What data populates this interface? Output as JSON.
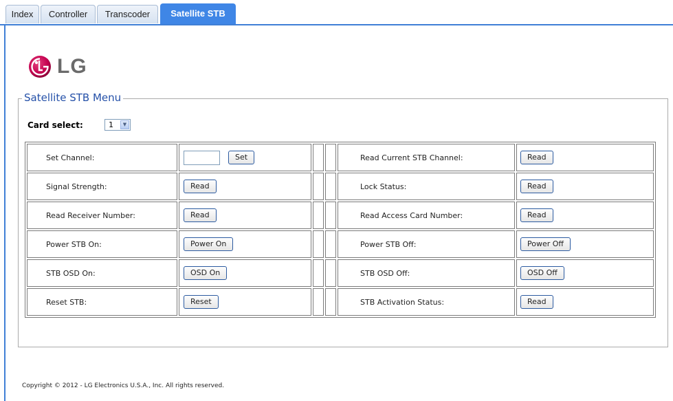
{
  "tabs": [
    {
      "label": "Index"
    },
    {
      "label": "Controller"
    },
    {
      "label": "Transcoder"
    },
    {
      "label": "Satellite STB",
      "active": true
    }
  ],
  "logo": {
    "text": "LG"
  },
  "menu": {
    "legend": "Satellite STB Menu",
    "card_select_label": "Card select:",
    "card_select_value": "1"
  },
  "rows": [
    {
      "left_label": "Set Channel:",
      "left_button": "Set",
      "right_label": "Read Current STB Channel:",
      "right_button": "Read"
    },
    {
      "left_label": "Signal Strength:",
      "left_button": "Read",
      "right_label": "Lock Status:",
      "right_button": "Read"
    },
    {
      "left_label": "Read Receiver Number:",
      "left_button": "Read",
      "right_label": "Read Access Card Number:",
      "right_button": "Read"
    },
    {
      "left_label": "Power STB On:",
      "left_button": "Power On",
      "right_label": "Power STB Off:",
      "right_button": "Power Off"
    },
    {
      "left_label": "STB OSD On:",
      "left_button": "OSD On",
      "right_label": "STB OSD Off:",
      "right_button": "OSD Off"
    },
    {
      "left_label": "Reset STB:",
      "left_button": "Reset",
      "right_label": "STB Activation Status:",
      "right_button": "Read"
    }
  ],
  "channel_input": {
    "value": ""
  },
  "footer": {
    "copyright": "Copyright © 2012 - LG Electronics U.S.A., Inc. All rights reserved."
  },
  "colors": {
    "accent": "#3f86e6",
    "legend": "#2450a8",
    "logo_red": "#c4004f"
  }
}
